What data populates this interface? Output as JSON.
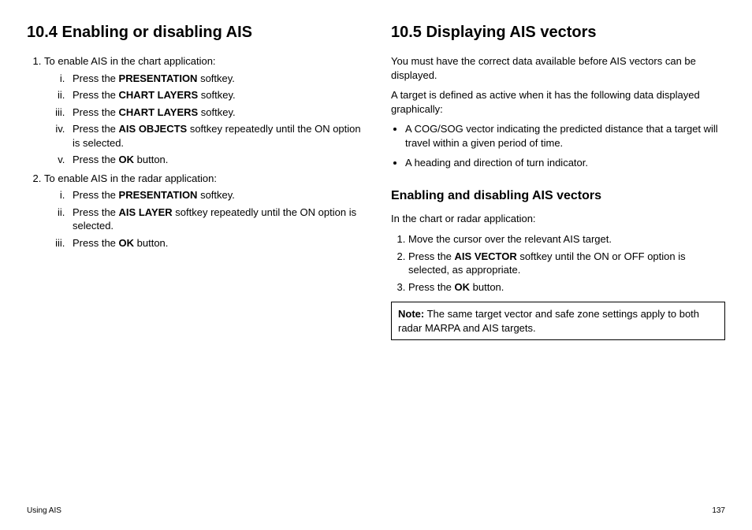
{
  "left": {
    "heading": "10.4 Enabling or disabling AIS",
    "step1_intro": "To enable AIS in the chart application:",
    "step1": {
      "i_a": "Press the ",
      "i_b": "PRESENTATION",
      "i_c": " softkey.",
      "ii_a": "Press the ",
      "ii_b": "CHART LAYERS",
      "ii_c": " softkey.",
      "iii_a": "Press the ",
      "iii_b": "CHART LAYERS",
      "iii_c": " softkey.",
      "iv_a": "Press the ",
      "iv_b": "AIS OBJECTS",
      "iv_c": " softkey repeatedly until the ON option is selected.",
      "v_a": "Press the ",
      "v_b": "OK",
      "v_c": " button."
    },
    "step2_intro": "To enable AIS in the radar application:",
    "step2": {
      "i_a": "Press the ",
      "i_b": "PRESENTATION",
      "i_c": " softkey.",
      "ii_a": "Press the ",
      "ii_b": "AIS LAYER",
      "ii_c": " softkey repeatedly until the ON option is selected.",
      "iii_a": "Press the ",
      "iii_b": "OK",
      "iii_c": " button."
    }
  },
  "right": {
    "heading": "10.5 Displaying AIS vectors",
    "p1": "You must have the correct data available before AIS vectors can be displayed.",
    "p2": "A target is defined as active when it has the following data displayed graphically:",
    "b1": "A COG/SOG vector indicating the predicted distance that a target will travel within a given period of time.",
    "b2": "A heading and direction of turn indicator.",
    "sub": "Enabling and disabling AIS vectors",
    "p3": "In the chart or radar application:",
    "s1": "Move the cursor over the relevant AIS target.",
    "s2_a": "Press the ",
    "s2_b": "AIS VECTOR",
    "s2_c": " softkey until the ON or OFF option is selected, as appropriate.",
    "s3_a": "Press the ",
    "s3_b": "OK",
    "s3_c": " button.",
    "note_label": "Note:",
    "note_body": " The same target vector and safe zone settings apply to both radar MARPA and AIS targets."
  },
  "footer_left": "Using AIS",
  "footer_right": "137"
}
